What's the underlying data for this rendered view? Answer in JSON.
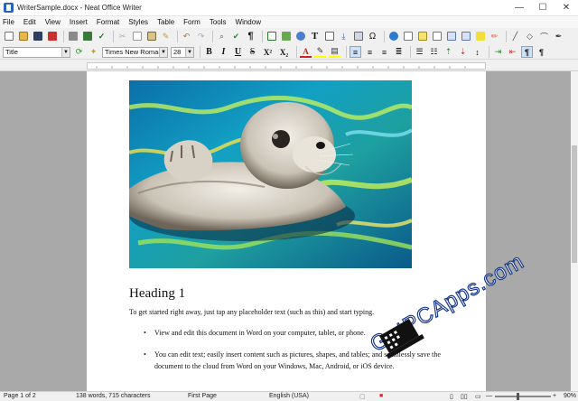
{
  "window": {
    "title": "WriterSample.docx - Neat Office Writer",
    "minimize_glyph": "—",
    "maximize_glyph": "☐",
    "close_glyph": "✕"
  },
  "menu": [
    "File",
    "Edit",
    "View",
    "Insert",
    "Format",
    "Styles",
    "Table",
    "Form",
    "Tools",
    "Window"
  ],
  "format_toolbar": {
    "style_value": "Title",
    "font_value": "Times New Roman",
    "size_value": "28",
    "bold": "B",
    "italic": "I",
    "underline": "U",
    "strike": "S",
    "superscript": "X²",
    "subscript": "X₂"
  },
  "document": {
    "heading": "Heading 1",
    "intro": "To get started right away, just tap any placeholder text (such as this) and start typing.",
    "bullets": [
      "View and edit this document in Word on your computer, tablet, or phone.",
      "You can edit text; easily insert content such as pictures, shapes, and tables; and seamlessly save the document to the cloud from Word on your Windows, Mac, Android, or iOS device."
    ]
  },
  "status": {
    "page": "Page 1 of 2",
    "words": "138 words, 715 characters",
    "page_style": "First Page",
    "language": "English (USA)",
    "zoom": "90%"
  },
  "watermark": {
    "text": "GetPCApps.com"
  },
  "colors": {
    "accent": "#2b63b7",
    "page_bg": "#ffffff",
    "doc_bg": "#a9a9a9"
  }
}
